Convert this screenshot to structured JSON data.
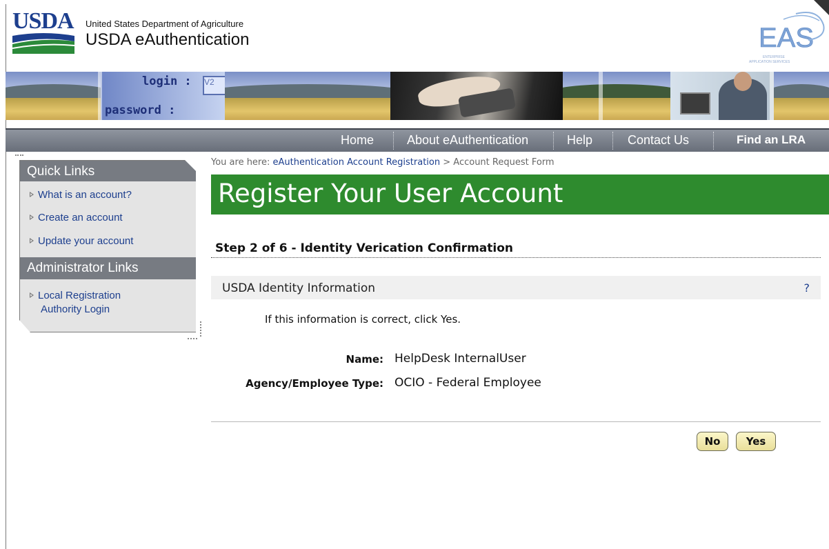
{
  "header": {
    "logo_text": "USDA",
    "department": "United States Department of Agriculture",
    "site_name": "USDA eAuthentication",
    "eas_logo_text": "EAS",
    "eas_logo_sub1": "ENTERPRISE",
    "eas_logo_sub2": "APPLICATION SERVICES"
  },
  "banner": {
    "login_text": "login :",
    "password_text": "password :",
    "field_text": "V2"
  },
  "nav": {
    "items": [
      {
        "label": "Home"
      },
      {
        "label": "About eAuthentication"
      },
      {
        "label": "Help"
      },
      {
        "label": "Contact Us"
      },
      {
        "label": "Find an LRA"
      }
    ]
  },
  "sidebar": {
    "quick_links_title": "Quick Links",
    "quick_links": [
      {
        "label": "What is an account?"
      },
      {
        "label": "Create an account"
      },
      {
        "label": "Update your account"
      }
    ],
    "admin_title": "Administrator Links",
    "admin_links": [
      {
        "line1": "Local Registration",
        "line2": "Authority Login"
      }
    ]
  },
  "breadcrumb": {
    "prefix": "You are here:",
    "link": "eAuthentication Account Registration",
    "separator": ">",
    "current": "Account Request Form"
  },
  "main": {
    "title": "Register Your User Account",
    "step": "Step 2 of 6 - Identity Verication Confirmation",
    "section_title": "USDA Identity Information",
    "help_symbol": "?",
    "instruction": "If this information is correct, click Yes.",
    "fields": [
      {
        "label": "Name:",
        "value": "HelpDesk InternalUser"
      },
      {
        "label": "Agency/Employee Type:",
        "value": "OCIO - Federal Employee"
      }
    ],
    "no_label": "No",
    "yes_label": "Yes"
  },
  "colors": {
    "title_bar": "#2e8b2e",
    "nav_bar": "#7b818c",
    "link": "#1d3f8e",
    "button": "#f4eeb4"
  }
}
